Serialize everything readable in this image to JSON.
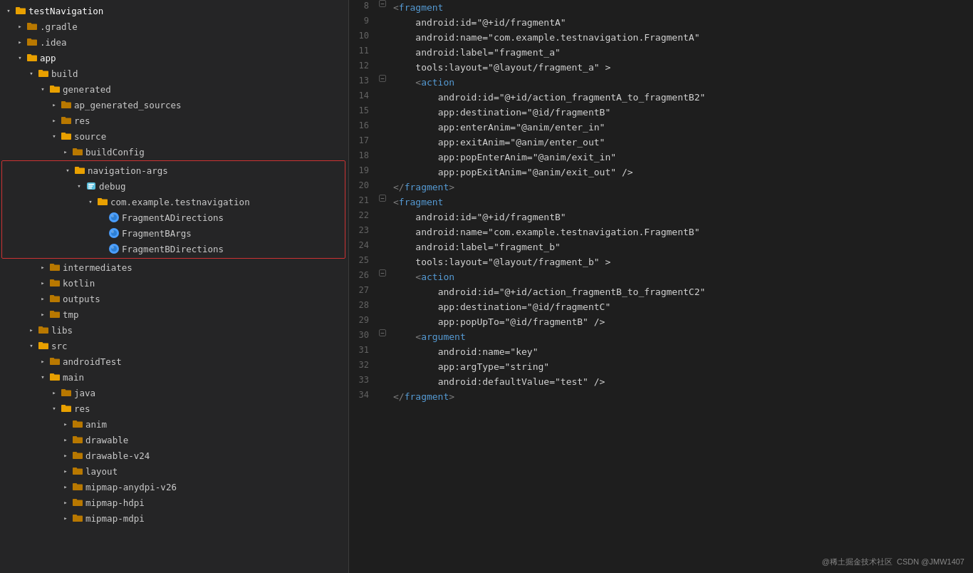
{
  "filetree": {
    "items": [
      {
        "id": "testnavigation",
        "label": "testNavigation",
        "type": "folder-open",
        "indent": 0,
        "arrow": "open",
        "bold": true
      },
      {
        "id": "gradle",
        "label": ".gradle",
        "type": "folder-closed",
        "indent": 1,
        "arrow": "closed"
      },
      {
        "id": "idea",
        "label": ".idea",
        "type": "folder-closed",
        "indent": 1,
        "arrow": "closed"
      },
      {
        "id": "app",
        "label": "app",
        "type": "folder-open",
        "indent": 1,
        "arrow": "open",
        "bold": true
      },
      {
        "id": "build",
        "label": "build",
        "type": "folder-open",
        "indent": 2,
        "arrow": "open"
      },
      {
        "id": "generated",
        "label": "generated",
        "type": "folder-open",
        "indent": 3,
        "arrow": "open"
      },
      {
        "id": "ap_generated_sources",
        "label": "ap_generated_sources",
        "type": "folder-closed",
        "indent": 4,
        "arrow": "closed"
      },
      {
        "id": "res",
        "label": "res",
        "type": "folder-closed",
        "indent": 4,
        "arrow": "closed"
      },
      {
        "id": "source",
        "label": "source",
        "type": "folder-open",
        "indent": 4,
        "arrow": "open"
      },
      {
        "id": "buildConfig",
        "label": "buildConfig",
        "type": "folder-closed",
        "indent": 5,
        "arrow": "closed"
      },
      {
        "id": "navigation-args",
        "label": "navigation-args",
        "type": "folder-open",
        "indent": 5,
        "arrow": "open",
        "highlight": true
      },
      {
        "id": "debug",
        "label": "debug",
        "type": "folder-open",
        "indent": 6,
        "arrow": "open",
        "highlight": true,
        "special": true
      },
      {
        "id": "com.example.testnavigation",
        "label": "com.example.testnavigation",
        "type": "folder-open",
        "indent": 7,
        "arrow": "open",
        "highlight": true
      },
      {
        "id": "FragmentADirections",
        "label": "FragmentADirections",
        "type": "java",
        "indent": 8,
        "arrow": "none",
        "highlight": true
      },
      {
        "id": "FragmentBArgs",
        "label": "FragmentBArgs",
        "type": "java",
        "indent": 8,
        "arrow": "none",
        "highlight": true
      },
      {
        "id": "FragmentBDirections",
        "label": "FragmentBDirections",
        "type": "java",
        "indent": 8,
        "arrow": "none",
        "highlight": true
      },
      {
        "id": "intermediates",
        "label": "intermediates",
        "type": "folder-closed",
        "indent": 3,
        "arrow": "closed"
      },
      {
        "id": "kotlin",
        "label": "kotlin",
        "type": "folder-closed",
        "indent": 3,
        "arrow": "closed"
      },
      {
        "id": "outputs",
        "label": "outputs",
        "type": "folder-closed",
        "indent": 3,
        "arrow": "closed"
      },
      {
        "id": "tmp",
        "label": "tmp",
        "type": "folder-closed",
        "indent": 3,
        "arrow": "closed"
      },
      {
        "id": "libs",
        "label": "libs",
        "type": "folder-closed",
        "indent": 2,
        "arrow": "closed"
      },
      {
        "id": "src",
        "label": "src",
        "type": "folder-open",
        "indent": 2,
        "arrow": "open"
      },
      {
        "id": "androidTest",
        "label": "androidTest",
        "type": "folder-closed",
        "indent": 3,
        "arrow": "closed"
      },
      {
        "id": "main",
        "label": "main",
        "type": "folder-open",
        "indent": 3,
        "arrow": "open"
      },
      {
        "id": "java",
        "label": "java",
        "type": "folder-closed",
        "indent": 4,
        "arrow": "closed"
      },
      {
        "id": "res2",
        "label": "res",
        "type": "folder-open",
        "indent": 4,
        "arrow": "open"
      },
      {
        "id": "anim",
        "label": "anim",
        "type": "folder-closed",
        "indent": 5,
        "arrow": "closed"
      },
      {
        "id": "drawable",
        "label": "drawable",
        "type": "folder-closed",
        "indent": 5,
        "arrow": "closed"
      },
      {
        "id": "drawable-v24",
        "label": "drawable-v24",
        "type": "folder-closed",
        "indent": 5,
        "arrow": "closed"
      },
      {
        "id": "layout",
        "label": "layout",
        "type": "folder-closed",
        "indent": 5,
        "arrow": "closed"
      },
      {
        "id": "mipmap-anydpi-v26",
        "label": "mipmap-anydpi-v26",
        "type": "folder-closed",
        "indent": 5,
        "arrow": "closed"
      },
      {
        "id": "mipmap-hdpi",
        "label": "mipmap-hdpi",
        "type": "folder-closed",
        "indent": 5,
        "arrow": "closed"
      },
      {
        "id": "mipmap-mdpi",
        "label": "mipmap-mdpi",
        "type": "folder-closed",
        "indent": 5,
        "arrow": "closed"
      }
    ]
  },
  "code": {
    "lines": [
      {
        "num": 8,
        "fold": true,
        "content": "<fragment"
      },
      {
        "num": 9,
        "fold": false,
        "content": "    android:id=\"@+id/fragmentA\""
      },
      {
        "num": 10,
        "fold": false,
        "content": "    android:name=\"com.example.testnavigation.FragmentA\""
      },
      {
        "num": 11,
        "fold": false,
        "content": "    android:label=\"fragment_a\""
      },
      {
        "num": 12,
        "fold": false,
        "content": "    tools:layout=\"@layout/fragment_a\" >"
      },
      {
        "num": 13,
        "fold": true,
        "content": "    <action"
      },
      {
        "num": 14,
        "fold": false,
        "content": "        android:id=\"@+id/action_fragmentA_to_fragmentB2\""
      },
      {
        "num": 15,
        "fold": false,
        "content": "        app:destination=\"@id/fragmentB\""
      },
      {
        "num": 16,
        "fold": false,
        "content": "        app:enterAnim=\"@anim/enter_in\""
      },
      {
        "num": 17,
        "fold": false,
        "content": "        app:exitAnim=\"@anim/enter_out\""
      },
      {
        "num": 18,
        "fold": false,
        "content": "        app:popEnterAnim=\"@anim/exit_in\""
      },
      {
        "num": 19,
        "fold": false,
        "content": "        app:popExitAnim=\"@anim/exit_out\" />"
      },
      {
        "num": 20,
        "fold": false,
        "content": "</fragment>"
      },
      {
        "num": 21,
        "fold": true,
        "content": "<fragment"
      },
      {
        "num": 22,
        "fold": false,
        "content": "    android:id=\"@+id/fragmentB\""
      },
      {
        "num": 23,
        "fold": false,
        "content": "    android:name=\"com.example.testnavigation.FragmentB\""
      },
      {
        "num": 24,
        "fold": false,
        "content": "    android:label=\"fragment_b\""
      },
      {
        "num": 25,
        "fold": false,
        "content": "    tools:layout=\"@layout/fragment_b\" >"
      },
      {
        "num": 26,
        "fold": true,
        "content": "    <action"
      },
      {
        "num": 27,
        "fold": false,
        "content": "        android:id=\"@+id/action_fragmentB_to_fragmentC2\""
      },
      {
        "num": 28,
        "fold": false,
        "content": "        app:destination=\"@id/fragmentC\""
      },
      {
        "num": 29,
        "fold": false,
        "content": "        app:popUpTo=\"@id/fragmentB\" />"
      },
      {
        "num": 30,
        "fold": true,
        "content": "    <argument"
      },
      {
        "num": 31,
        "fold": false,
        "content": "        android:name=\"key\""
      },
      {
        "num": 32,
        "fold": false,
        "content": "        app:argType=\"string\""
      },
      {
        "num": 33,
        "fold": false,
        "content": "        android:defaultValue=\"test\" />"
      },
      {
        "num": 34,
        "fold": false,
        "content": "</fragment>"
      }
    ]
  },
  "watermark": "@稀土掘金技术社区",
  "watermark2": "CSDN @JMW1407"
}
